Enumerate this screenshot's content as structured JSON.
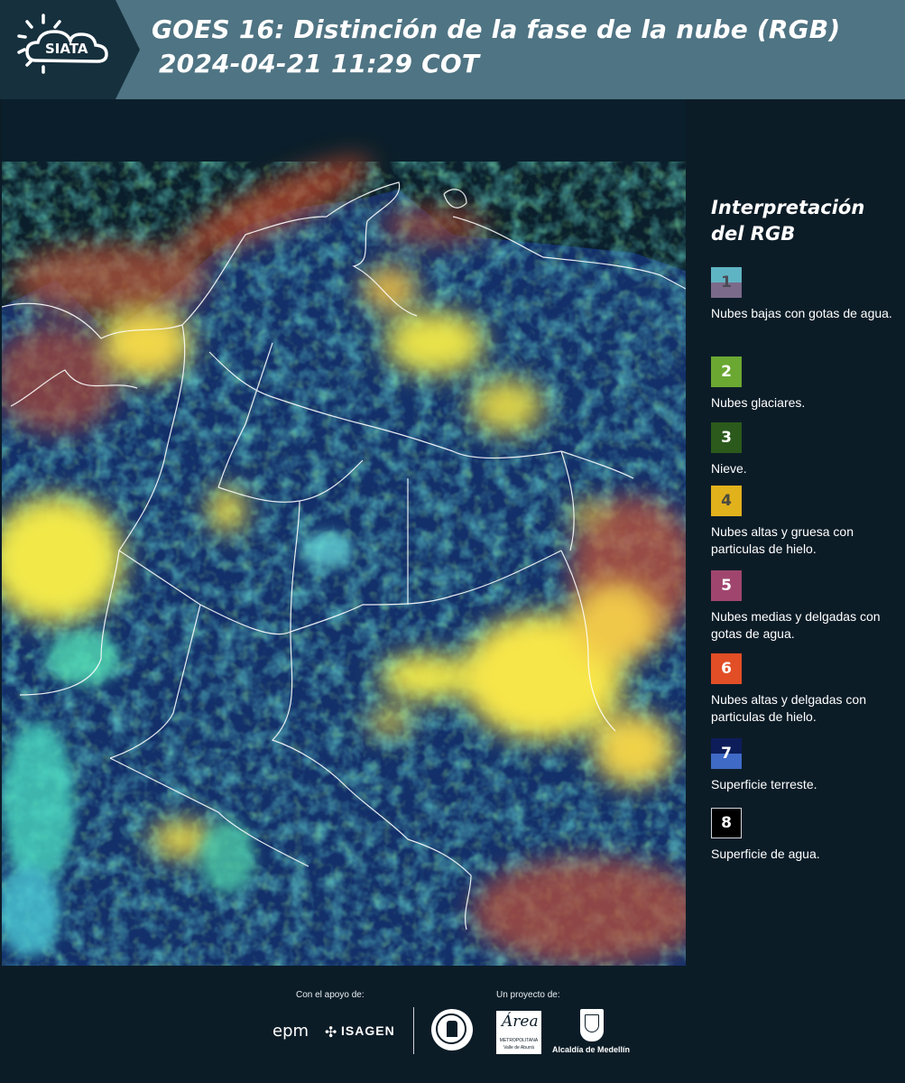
{
  "header": {
    "logo_text": "SIATA",
    "title_line1": "GOES 16: Distinción de la fase de la nube (RGB)",
    "title_line2": "2024-04-21 11:29 COT"
  },
  "legend": {
    "title": "Interpretación del RGB",
    "items": [
      {
        "number": "1",
        "label": "Nubes bajas con gotas de agua.",
        "color_top": "#5fb4c4",
        "color_bottom": "#7c6a8a"
      },
      {
        "number": "2",
        "label": "Nubes glaciares.",
        "color_top": "#6aa832",
        "color_bottom": "#6aa832"
      },
      {
        "number": "3",
        "label": "Nieve.",
        "color_top": "#2b5a1c",
        "color_bottom": "#2b5a1c"
      },
      {
        "number": "4",
        "label": "Nubes altas y gruesa con particulas de hielo.",
        "color_top": "#e2b21c",
        "color_bottom": "#e2b21c"
      },
      {
        "number": "5",
        "label": "Nubes medias y delgadas con gotas de agua.",
        "color_top": "#a0466e",
        "color_bottom": "#a0466e"
      },
      {
        "number": "6",
        "label": "Nubes altas y delgadas con particulas de hielo.",
        "color_top": "#e24e26",
        "color_bottom": "#e24e26"
      },
      {
        "number": "7",
        "label": "Superficie terreste.",
        "color_top": "#0d1d5a",
        "color_bottom": "#3f6ac6"
      },
      {
        "number": "8",
        "label": "Superficie de agua.",
        "color_top": "#000000",
        "color_bottom": "#000000"
      }
    ]
  },
  "footer": {
    "support_label": "Con el apoyo de:",
    "project_label": "Un proyecto de:",
    "sponsor_epm": "epm",
    "sponsor_isagen": "ISAGEN",
    "area_logo_text": "Área",
    "area_sub1": "METROPOLITANA",
    "area_sub2": "Valle de Aburrá",
    "alcaldia_label": "Alcaldía de Medellín"
  }
}
